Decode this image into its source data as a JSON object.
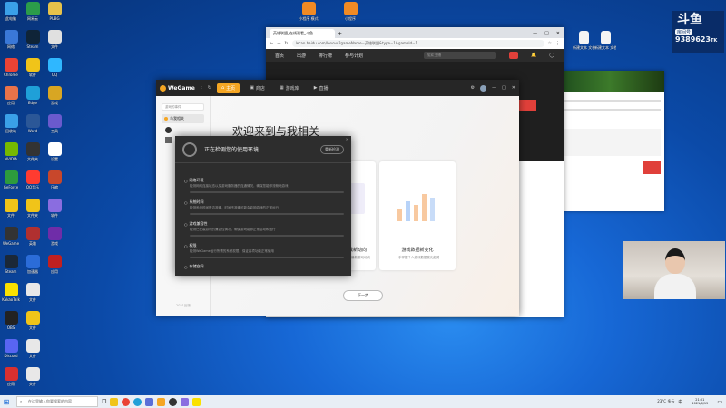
{
  "colors": {
    "accent": "#f5a623",
    "red": "#e0403a",
    "dark": "#262626"
  },
  "desktop": {
    "top_icons": [
      {
        "label": "小程序\n模式",
        "color": "#f08a24"
      },
      {
        "label": "小程序",
        "color": "#f08a24"
      }
    ],
    "right_icons": [
      {
        "label": "新建文本\n文档",
        "color": "#f4f4f4"
      },
      {
        "label": "新建文本\n文档",
        "color": "#f4f4f4"
      }
    ],
    "icons": [
      {
        "label": "此电脑",
        "color": "#3aa0e8"
      },
      {
        "label": "网易云",
        "color": "#2b9c4a"
      },
      {
        "label": "PUBG",
        "color": "#e6c24a"
      },
      {
        "label": "网络",
        "color": "#3a78d8"
      },
      {
        "label": "Steam",
        "color": "#0f2438"
      },
      {
        "label": "文件",
        "color": "#e0e0e0"
      },
      {
        "label": "Chrome",
        "color": "#ea4335"
      },
      {
        "label": "软件",
        "color": "#f0c419"
      },
      {
        "label": "QQ",
        "color": "#2fb7ff"
      },
      {
        "label": "应用",
        "color": "#e8734a"
      },
      {
        "label": "Edge",
        "color": "#1fa0d8"
      },
      {
        "label": "游戏",
        "color": "#d8a623"
      },
      {
        "label": "回收站",
        "color": "#3aa0e8"
      },
      {
        "label": "Word",
        "color": "#2b5797"
      },
      {
        "label": "工具",
        "color": "#6a5acd"
      },
      {
        "label": "NVIDIA",
        "color": "#76b900"
      },
      {
        "label": "文件夹",
        "color": "#333"
      },
      {
        "label": "设置",
        "color": "#fff"
      },
      {
        "label": "GeForce",
        "color": "#2d9b3d"
      },
      {
        "label": "QQ音乐",
        "color": "#ff3b30"
      },
      {
        "label": "压缩",
        "color": "#c8472b"
      },
      {
        "label": "文件",
        "color": "#f0c419"
      },
      {
        "label": "文件夹",
        "color": "#f0c419"
      },
      {
        "label": "软件",
        "color": "#8a6de0"
      },
      {
        "label": "WeGame",
        "color": "#333"
      },
      {
        "label": "英雄",
        "color": "#b03030"
      },
      {
        "label": "游戏",
        "color": "#6f2da8"
      },
      {
        "label": "Steam",
        "color": "#1b2838"
      },
      {
        "label": "加速器",
        "color": "#2b6cd8"
      },
      {
        "label": "应用",
        "color": "#c02020"
      },
      {
        "label": "KakaoTalk",
        "color": "#fae100"
      },
      {
        "label": "文件",
        "color": "#e8e8e8"
      },
      {
        "label": "OBS",
        "color": "#222"
      },
      {
        "label": "文件",
        "color": "#f0c419"
      },
      {
        "label": "Discord",
        "color": "#5865f2"
      },
      {
        "label": "文件",
        "color": "#e8e8e8"
      },
      {
        "label": "应用",
        "color": "#d83030"
      },
      {
        "label": "文件",
        "color": "#e8e8e8"
      }
    ]
  },
  "stream": {
    "logo": "斗鱼",
    "room_label": "房间号",
    "room_number": "9389623",
    "suffix": "TK"
  },
  "browser": {
    "tab_title": "英雄联盟_在线观看_斗鱼",
    "url": "lecan.baidu.com/lenovo?gameName=英雄联盟&type=1&gameId=1",
    "site_nav": [
      "首页",
      "出游",
      "排行榜",
      "参与计划"
    ],
    "search_placeholder": "搜索主播"
  },
  "wegame": {
    "logo": "WeGame",
    "nav": [
      {
        "label": "主页",
        "active": true
      },
      {
        "label": "商店",
        "active": false
      },
      {
        "label": "游戏库",
        "active": false
      },
      {
        "label": "直播",
        "active": false
      }
    ],
    "sidebar": [
      {
        "label": "游戏的事件"
      },
      {
        "label": "与我相关"
      }
    ],
    "version": "2021反馈",
    "welcome": "欢迎来到与我相关",
    "cards": [
      {
        "title": "好友游戏新动向",
        "desc": "不要错过好友最新游戏动向"
      },
      {
        "title": "游戏数据新变化",
        "desc": "一手掌握个人游戏数据变化趋势"
      }
    ],
    "next_button": "下一步"
  },
  "modal": {
    "title": "正在检测您的使用环境...",
    "button": "重新检测",
    "items": [
      {
        "title": "网络环境",
        "desc": "检测网络连接状态以及游戏服务器的连通情况，确保您能够流畅地游戏"
      },
      {
        "title": "系统时间",
        "desc": "检测系统时间是否准确，时间不准确可能会影响游戏的正常运行"
      },
      {
        "title": "游戏兼容性",
        "desc": "检测已安装游戏的兼容性情况，确保游戏能够正常启动和运行"
      },
      {
        "title": "权限",
        "desc": "检测WeGame运行所需的系统权限，保证各项功能正常使用"
      },
      {
        "title": "存储空间",
        "desc": "检测磁盘剩余空间"
      }
    ]
  },
  "taskbar": {
    "search_placeholder": "在这里输入你要搜索的内容",
    "temp": "23°C 多云",
    "ime": "中",
    "time": "21:01",
    "date": "2021/6/15"
  }
}
